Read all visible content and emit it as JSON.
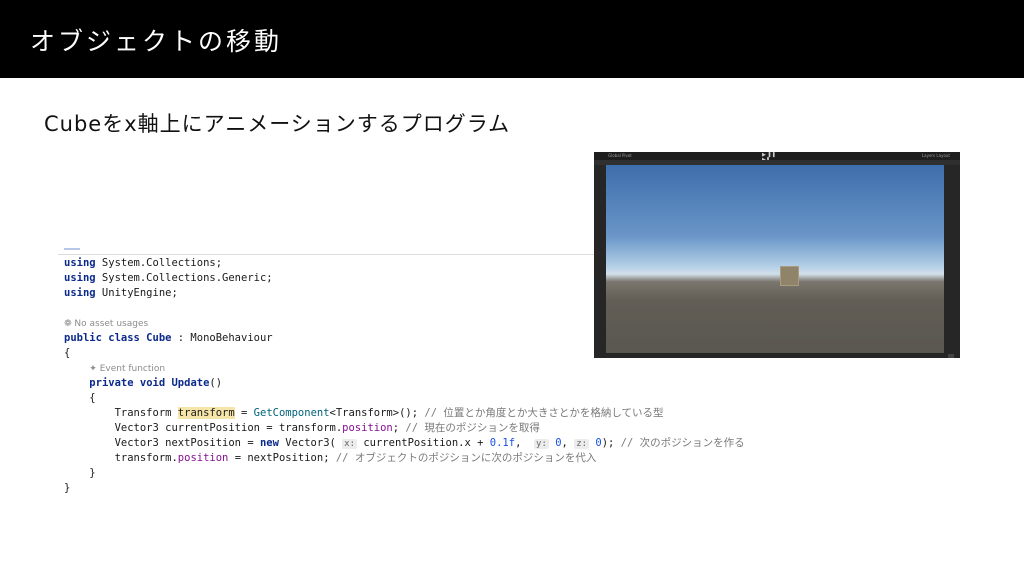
{
  "slide": {
    "title": "オブジェクトの移動",
    "subtitle": "Cubeをx軸上にアニメーションするプログラム"
  },
  "code": {
    "using1_kw": "using",
    "using1_rest": " System.Collections;",
    "using2_kw": "using",
    "using2_rest": " System.Collections.Generic;",
    "using3_kw": "using",
    "using3_rest": " UnityEngine;",
    "hint_usages": "❁ No asset usages",
    "class_kw": "public class",
    "class_name": " Cube",
    "class_rest": " : MonoBehaviour",
    "brace_open": "{",
    "hint_event": "✦ Event function",
    "method_kw": "private void",
    "method_name": " Update",
    "method_parens": "()",
    "inner_open": "{",
    "line1_type": "Transform ",
    "line1_var": "transform",
    "line1_eq": " = ",
    "line1_call": "GetComponent",
    "line1_rest": "<Transform>();",
    "line1_comment": " // 位置とか角度とか大きさとかを格納している型",
    "line2_a": "Vector3 currentPosition = transform.",
    "line2_field": "position",
    "line2_b": ";",
    "line2_comment": " // 現在のポジションを取得",
    "line3_a": "Vector3 nextPosition = ",
    "line3_new": "new",
    "line3_b": " Vector3( ",
    "line3_px": "x:",
    "line3_c": " currentPosition.x + ",
    "line3_num1": "0.1f",
    "line3_d": ",  ",
    "line3_py": "y:",
    "line3_num2": " 0",
    "line3_e": ", ",
    "line3_pz": "z:",
    "line3_num3": " 0",
    "line3_f": ");",
    "line3_comment": " // 次のポジションを作る",
    "line4_a": "transform.",
    "line4_field": "position",
    "line4_b": " = nextPosition;",
    "line4_comment": " // オブジェクトのポジションに次のポジションを代入",
    "inner_close": "}",
    "brace_close": "}"
  },
  "unity": {
    "toolbar_left": "Global  Pivot",
    "play_controls": "▶ ❚❚ ▶❚",
    "toolbar_right": "Layers  Layout",
    "sky_color": "#3d6dab",
    "ground_color": "#5e5a53",
    "cube_color": "#8f8469"
  }
}
